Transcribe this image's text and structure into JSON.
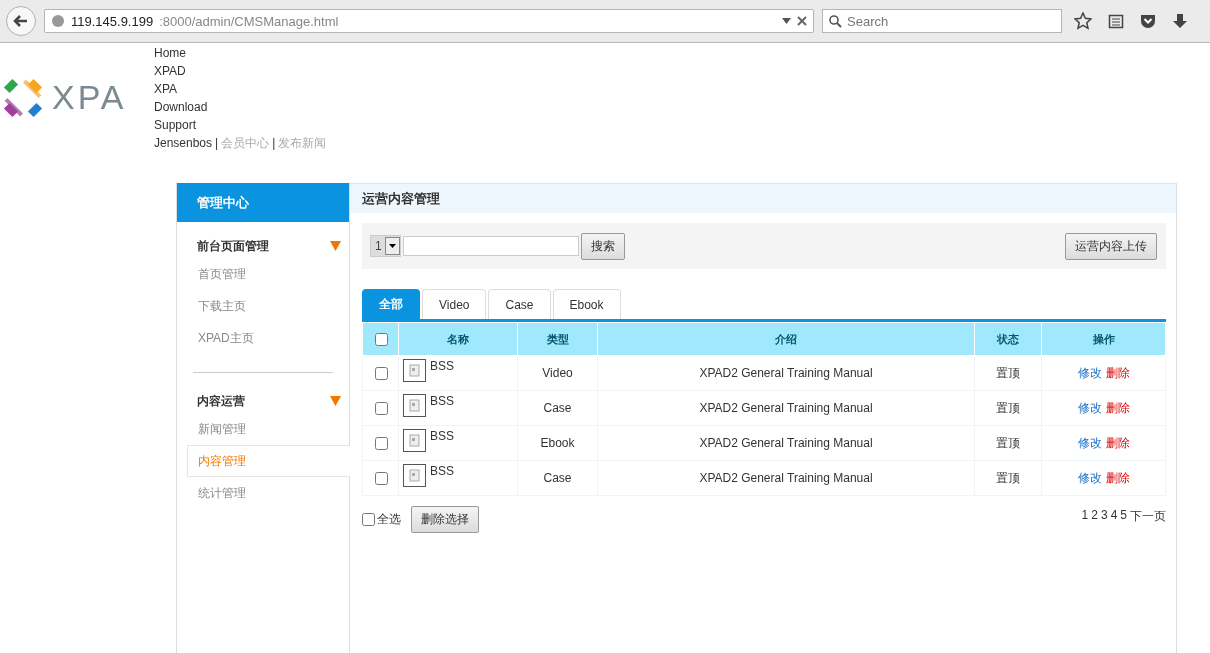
{
  "browser": {
    "url_host": "119.145.9.199",
    "url_path": ":8000/admin/CMSManage.html",
    "search_placeholder": "Search"
  },
  "header": {
    "logo_text": "XPA",
    "nav": [
      "Home",
      "XPAD",
      "XPA",
      "Download",
      "Support"
    ],
    "user": {
      "name": "Jensenbos",
      "separator": "|",
      "links": [
        "会员中心",
        "发布新闻"
      ]
    }
  },
  "sidebar": {
    "title": "管理中心",
    "groups": [
      {
        "title": "前台页面管理",
        "expanded": true,
        "items": [
          {
            "label": "首页管理",
            "selected": false
          },
          {
            "label": "下载主页",
            "selected": false
          },
          {
            "label": "XPAD主页",
            "selected": false
          }
        ]
      },
      {
        "title": "内容运营",
        "expanded": true,
        "items": [
          {
            "label": "新闻管理",
            "selected": false
          },
          {
            "label": "内容管理",
            "selected": true
          },
          {
            "label": "统计管理",
            "selected": false
          }
        ]
      }
    ]
  },
  "main": {
    "title": "运营内容管理",
    "select_value": "1",
    "search_button": "搜索",
    "upload_button": "运营内容上传",
    "tabs": [
      {
        "label": "全部",
        "selected": true
      },
      {
        "label": "Video",
        "selected": false
      },
      {
        "label": "Case",
        "selected": false
      },
      {
        "label": "Ebook",
        "selected": false
      }
    ],
    "table": {
      "columns": [
        "名称",
        "类型",
        "介绍",
        "状态",
        "操作"
      ],
      "header_checked": false,
      "rows": [
        {
          "checked": false,
          "name": "BSS",
          "type": "Video",
          "intro": "XPAD2 General Training Manual",
          "status": "置顶",
          "edit": "修改",
          "delete": "删除"
        },
        {
          "checked": false,
          "name": "BSS",
          "type": "Case",
          "intro": "XPAD2 General Training Manual",
          "status": "置顶",
          "edit": "修改",
          "delete": "删除"
        },
        {
          "checked": false,
          "name": "BSS",
          "type": "Ebook",
          "intro": "XPAD2 General Training Manual",
          "status": "置顶",
          "edit": "修改",
          "delete": "删除"
        },
        {
          "checked": false,
          "name": "BSS",
          "type": "Case",
          "intro": "XPAD2 General Training Manual",
          "status": "置顶",
          "edit": "修改",
          "delete": "删除"
        }
      ]
    },
    "select_all": {
      "label": "全选",
      "checked": false
    },
    "delete_selected": "删除选择",
    "pagination": {
      "pages": [
        "1",
        "2",
        "3",
        "4",
        "5"
      ],
      "next": "下一页"
    }
  }
}
